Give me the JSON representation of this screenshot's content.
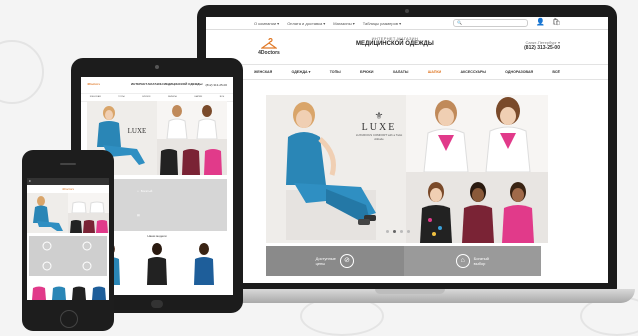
{
  "site": {
    "topbar": [
      "О компании ▾",
      "Оплата и доставка ▾",
      "Магазины ▾",
      "Таблицы размеров ▾"
    ],
    "search_placeholder": "",
    "logo_text": "4Doctors",
    "logo_sub": "",
    "store_subtitle": "ИНТЕРНЕТ-МАГАЗИН",
    "store_title": "МЕДИЦИНСКОЙ ОДЕЖДЫ",
    "city": "Санкт-Петербург ▾",
    "phone": "(812) 313-25-00",
    "nav": [
      "ЖЕНСКАЯ",
      "ОДЕЖДА ▾",
      "ТОПЫ",
      "БРЮКИ",
      "ХАЛАТЫ",
      "ШАПКИ",
      "АКСЕССУАРЫ",
      "ОДНОРАЗОВАЯ",
      "ВСЁ"
    ],
    "active_nav": "ШАПКИ",
    "banner": {
      "brand": "LUXE",
      "tagline": "LUXURIOUS COMFORT with a Twist Attitude"
    },
    "features": [
      {
        "label_line1": "Доступные",
        "label_line2": "цены",
        "icon": "price-tag-icon"
      },
      {
        "label_line1": "Богатый",
        "label_line2": "выбор",
        "icon": "hanger-icon"
      }
    ]
  },
  "tablet": {
    "logo": "4Doctors",
    "title": "ИНТЕРНЕТ-МАГАЗИН МЕДИЦИНСКОЙ ОДЕЖДЫ",
    "phone": "(812) 313-25-00",
    "nav": [
      "ЖЕНСКАЯ",
      "ТОПЫ",
      "БРЮКИ",
      "ХАЛАТЫ",
      "ШАПКИ",
      "ВСЁ"
    ],
    "brand": "LUXE",
    "models_title": "Наши модели"
  },
  "phone": {
    "logo": "4Doctors"
  },
  "colors": {
    "accent": "#e07a29",
    "teal_scrubs": "#2a86b6",
    "white_coat": "#ffffff",
    "pink": "#e13a8a",
    "burgundy": "#7a2335",
    "device": "#1b1b1b"
  }
}
